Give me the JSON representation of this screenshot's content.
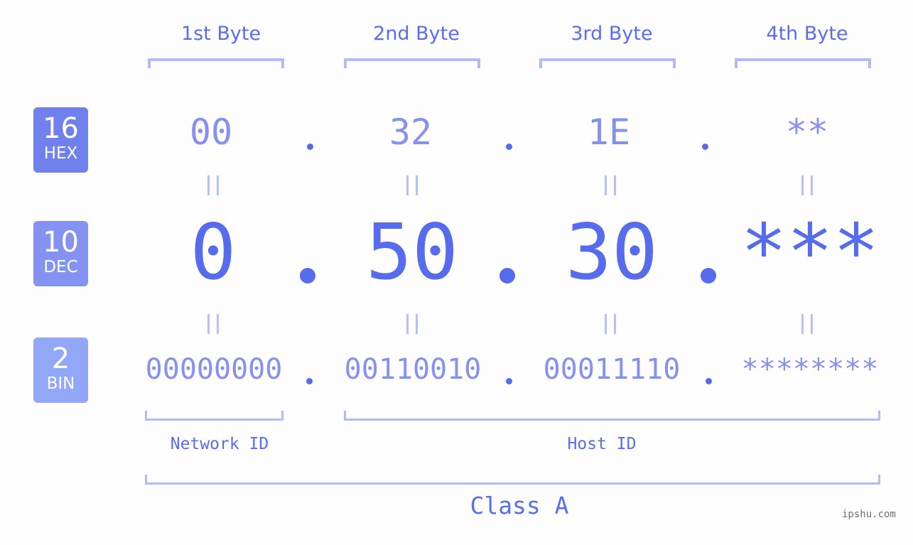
{
  "bytes": {
    "labels": [
      "1st Byte",
      "2nd Byte",
      "3rd Byte",
      "4th Byte"
    ]
  },
  "bases": [
    {
      "number": "16",
      "name": "HEX",
      "color": "#7080ec"
    },
    {
      "number": "10",
      "name": "DEC",
      "color": "#8493f1"
    },
    {
      "number": "2",
      "name": "BIN",
      "color": "#93a7f8"
    }
  ],
  "hex": [
    "00",
    "32",
    "1E",
    "**"
  ],
  "dec": [
    "0",
    "50",
    "30",
    "***"
  ],
  "bin": [
    "00000000",
    "00110010",
    "00011110",
    "********"
  ],
  "separator": ".",
  "equals_symbol": "=",
  "segments": {
    "network_label": "Network ID",
    "host_label": "Host ID",
    "class_label": "Class A"
  },
  "watermark": "ipshu.com",
  "colors": {
    "accent": "#566cec",
    "light_value": "#8691ee",
    "bracket": "#b1bcf6",
    "background": "#fcfdfc"
  }
}
